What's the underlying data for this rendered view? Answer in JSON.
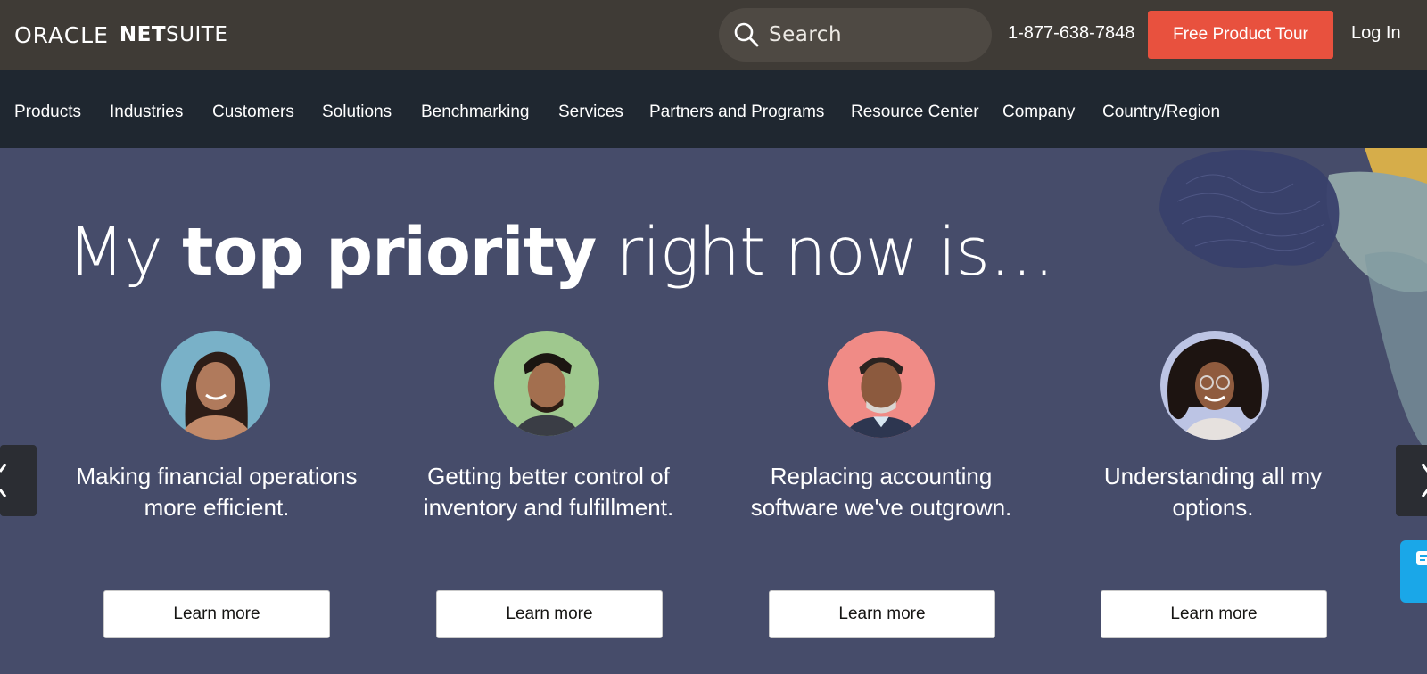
{
  "header": {
    "logo_oracle": "ORACLE",
    "logo_net": "NET",
    "logo_suite": "SUITE",
    "search_placeholder": "Search",
    "phone": "1-877-638-7848",
    "tour_label": "Free Product Tour",
    "login_label": "Log In"
  },
  "nav": {
    "items": [
      {
        "label": "Products"
      },
      {
        "label": "Industries"
      },
      {
        "label": "Customers"
      },
      {
        "label": "Solutions"
      },
      {
        "label": "Benchmarking"
      },
      {
        "label": "Services"
      },
      {
        "label": "Partners and Programs"
      },
      {
        "label": "Resource Center"
      },
      {
        "label": "Company"
      },
      {
        "label": "Country/Region"
      }
    ]
  },
  "hero": {
    "headline_start": "My ",
    "headline_bold": "top priority",
    "headline_end": " right now is…",
    "cards": [
      {
        "text": "Making financial operations more efficient.",
        "cta": "Learn more",
        "avatar_bg": "#79b1c8"
      },
      {
        "text": "Getting better control of inventory and fulfillment.",
        "cta": "Learn more",
        "avatar_bg": "#9fc88e"
      },
      {
        "text": "Replacing accounting software we've outgrown.",
        "cta": "Learn more",
        "avatar_bg": "#f08b86"
      },
      {
        "text": "Understanding all my options.",
        "cta": "Learn more",
        "avatar_bg": "#bcc4e4"
      }
    ]
  },
  "colors": {
    "topbar": "#3f3b36",
    "nav": "#1f2730",
    "hero": "#464c6a",
    "cta": "#e8513e",
    "chat": "#1aa7e8"
  }
}
